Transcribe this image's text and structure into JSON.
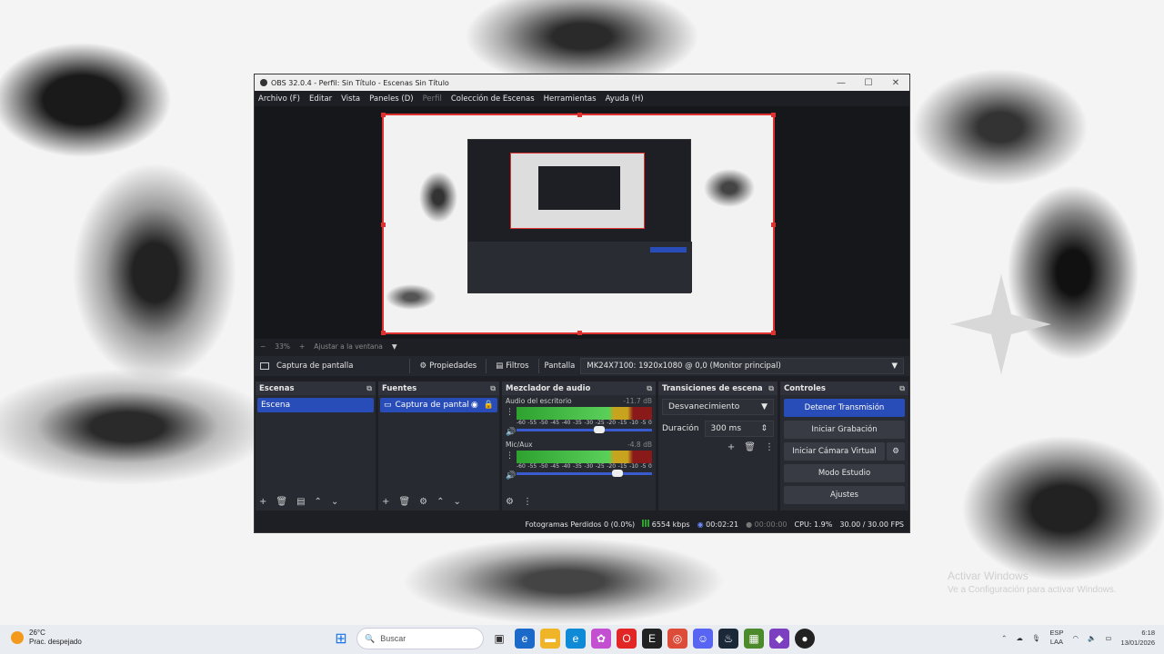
{
  "obs": {
    "title": "OBS 32.0.4 - Perfil: Sin Título - Escenas Sin Título",
    "menu": [
      "Archivo (F)",
      "Editar",
      "Vista",
      "Paneles (D)",
      "Perfil",
      "Colección de Escenas",
      "Herramientas",
      "Ayuda (H)"
    ],
    "zoom": {
      "minus": "−",
      "value": "33%",
      "plus": "+",
      "fit": "Ajustar a la ventana",
      "arrow": "▼"
    },
    "source_bar": {
      "source_name": "Captura de pantalla",
      "properties": "Propiedades",
      "filters": "Filtros",
      "screen_label": "Pantalla",
      "screen_value": "MK24X7100: 1920x1080 @ 0,0 (Monitor principal)"
    },
    "scenes": {
      "header": "Escenas",
      "items": [
        "Escena"
      ]
    },
    "sources": {
      "header": "Fuentes",
      "items": [
        "Captura de pantal"
      ]
    },
    "mixer": {
      "header": "Mezclador de audio",
      "channels": [
        {
          "name": "Audio del escritorio",
          "db": "-11.7 dB",
          "level": 0.71,
          "fader": 0.6
        },
        {
          "name": "Mic/Aux",
          "db": "-4.8 dB",
          "level": 0.83,
          "fader": 0.75
        }
      ],
      "scale": [
        "-60",
        "-55",
        "-50",
        "-45",
        "-40",
        "-35",
        "-30",
        "-25",
        "-20",
        "-15",
        "-10",
        "-5",
        "0"
      ]
    },
    "transitions": {
      "header": "Transiciones de escena",
      "type": "Desvanecimiento",
      "duration_label": "Duración",
      "duration_value": "300 ms"
    },
    "controls": {
      "header": "Controles",
      "stop_stream": "Detener Transmisión",
      "start_record": "Iniciar Grabación",
      "virtual_cam": "Iniciar Cámara Virtual",
      "studio_mode": "Modo Estudio",
      "settings": "Ajustes"
    },
    "status": {
      "dropped": "Fotogramas Perdidos 0 (0.0%)",
      "bitrate": "6554 kbps",
      "stream_time": "00:02:21",
      "rec_time": "00:00:00",
      "cpu": "CPU: 1.9%",
      "fps": "30.00 / 30.00 FPS"
    }
  },
  "desktop": {
    "watermark_line1": "Activar Windows",
    "watermark_line2": "Ve a Configuración para activar Windows."
  },
  "taskbar": {
    "weather_temp": "26°C",
    "weather_desc": "Prac. despejado",
    "search_placeholder": "Buscar",
    "lang_top": "ESP",
    "lang_bottom": "LAA",
    "time": "6:18",
    "date": "13/01/2026"
  },
  "colors": {
    "accent": "#284cb8",
    "record_border": "#e03131",
    "dock_bg": "#272a31",
    "meter_green": "#2ea12e"
  }
}
